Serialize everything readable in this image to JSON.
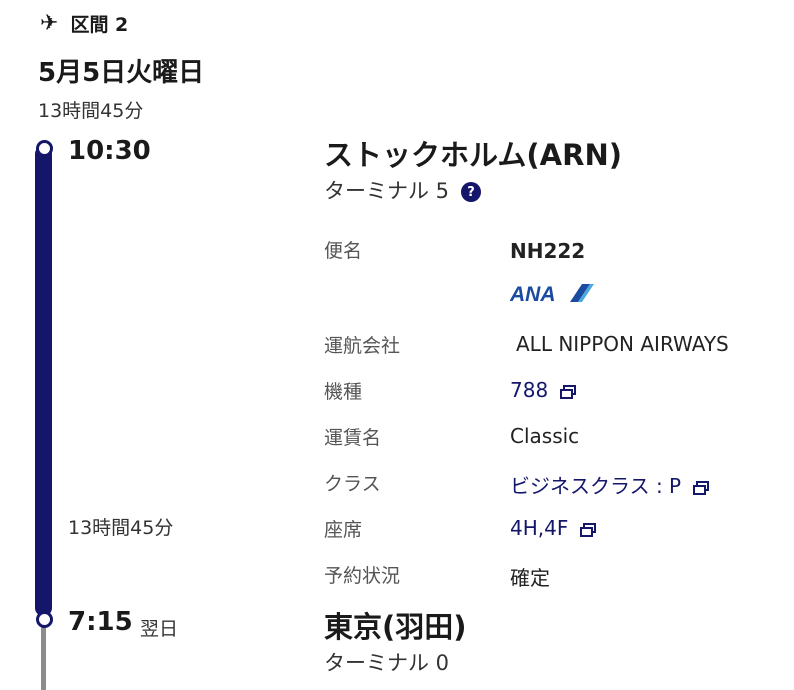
{
  "segment": {
    "header": "区間 2",
    "date": "5月5日火曜日",
    "total_duration": "13時間45分"
  },
  "departure": {
    "time": "10:30",
    "city": "ストックホルム(ARN)",
    "terminal": "ターミナル 5"
  },
  "middle_duration": "13時間45分",
  "details": {
    "flight_label": "便名",
    "flight_value": "NH222",
    "airline_logo_text": "ANA",
    "operator_label": "運航会社",
    "operator_value": "ALL NIPPON AIRWAYS",
    "aircraft_label": "機種",
    "aircraft_value": "788",
    "fare_label": "運賃名",
    "fare_value": "Classic",
    "class_label": "クラス",
    "class_value": "ビジネスクラス : P",
    "seat_label": "座席",
    "seat_value": "4H,4F",
    "status_label": "予約状況",
    "status_value": "確定"
  },
  "arrival": {
    "time": "7:15",
    "next_day": "翌日",
    "city": "東京(羽田)",
    "terminal": "ターミナル 0"
  },
  "icons": {
    "header": "airplane-icon",
    "help": "help-icon",
    "external": "external-link-icon"
  },
  "colors": {
    "accent": "#14166a",
    "ana_blue": "#1a4ba0",
    "timeline_tail": "#8c8c8c"
  }
}
